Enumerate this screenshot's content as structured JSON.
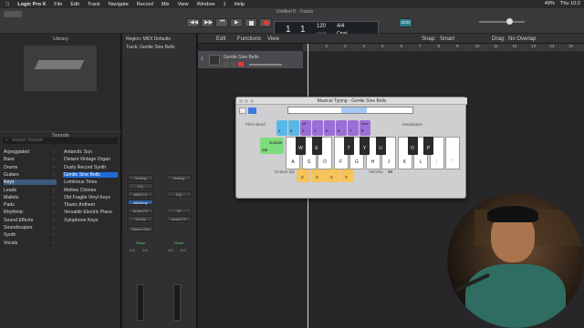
{
  "menubar": {
    "app": "Logic Pro X",
    "items": [
      "File",
      "Edit",
      "Track",
      "Navigate",
      "Record",
      "Mix",
      "View",
      "Window",
      "1",
      "Help"
    ],
    "battery": "49%",
    "time": "Thu 10:2"
  },
  "toolbar": {
    "title": "Untitled 8 - Tracks",
    "lcd": {
      "bar": "1",
      "beat": "1",
      "tempo": "120",
      "tempo_label": "KEEP",
      "sig": "4/4",
      "key": "Cmaj"
    },
    "counter": "d234"
  },
  "library": {
    "title": "Library",
    "sounds_label": "Sounds",
    "search_placeholder": "Search Sounds",
    "categories": [
      "Arpeggiated",
      "Bass",
      "Drums",
      "Guitars",
      "Keys",
      "Leads",
      "Mallets",
      "Pads",
      "Rhythmic",
      "Sound Effects",
      "Soundscapes",
      "Synth",
      "Vocals"
    ],
    "patches": [
      "Antarctic Sun",
      "Distant Vintage Organ",
      "Dusty Record Synth",
      "Gentle Sine Bells",
      "Luminous Tines",
      "Mellow Chimes",
      "Old Fragile Vinyl Keys",
      "Titanic Anthem",
      "Versatile Electric Piano",
      "Xylophone Keys"
    ]
  },
  "inspector": {
    "region": "Region: MIDI Defaults",
    "track": "Track: Gentle Sine Bells",
    "strip1": {
      "setting": "Setting",
      "eq": "EQ",
      "midi_fx": "MIDI FX",
      "inst": "Alchemy",
      "audio_fx": "Audio FX",
      "sends": "Sends",
      "output": "Stereo Out",
      "read": "Read",
      "vol": "0.0",
      "pan": "0.0"
    },
    "strip2": {
      "setting": "Setting",
      "eq": "EQ",
      "inst": "ID",
      "audio_fx": "Audio FX",
      "read": "Read",
      "vol": "0.0",
      "pan": "0.0"
    }
  },
  "tracks": {
    "edit": "Edit",
    "functions": "Functions",
    "view": "View",
    "snap_label": "Snap:",
    "snap": "Smart",
    "drag_label": "Drag:",
    "drag": "No Overlap",
    "track_name": "Gentle Sine Bells",
    "track_num": "1",
    "ruler": [
      "1",
      "2",
      "3",
      "4",
      "5",
      "6",
      "7",
      "8",
      "9",
      "10",
      "11",
      "12",
      "13",
      "14",
      "15"
    ]
  },
  "musical_typing": {
    "title": "Musical Typing - Gentle Sine Bells",
    "pitch_bend": "Pitch Bend",
    "modulation": "Modulation",
    "octave": "Octave:",
    "octave_val": "C2",
    "velocity": "Velocity:",
    "velocity_val": "98",
    "sustain": "sustain",
    "tab": "tab",
    "top_keys": [
      {
        "k": "1",
        "c": "#5ab8e8"
      },
      {
        "k": "2",
        "c": "#5ab8e8"
      },
      {
        "k": "3",
        "c": "#9b6fd8",
        "sub": "off"
      },
      {
        "k": "4",
        "c": "#9b6fd8"
      },
      {
        "k": "5",
        "c": "#9b6fd8"
      },
      {
        "k": "6",
        "c": "#9b6fd8"
      },
      {
        "k": "7",
        "c": "#9b6fd8"
      },
      {
        "k": "8",
        "c": "#9b6fd8",
        "sub": "max"
      }
    ],
    "white_keys": [
      "A",
      "S",
      "D",
      "F",
      "G",
      "H",
      "J",
      "K",
      "L",
      ";",
      "'"
    ],
    "black_keys": [
      "W",
      "E",
      "T",
      "Y",
      "U",
      "O",
      "P"
    ],
    "bottom_keys": [
      "Z",
      "X",
      "C",
      "V"
    ]
  },
  "colors": {
    "accent": "#1f6ad6",
    "record": "#e23b3b",
    "green": "#68c568"
  }
}
